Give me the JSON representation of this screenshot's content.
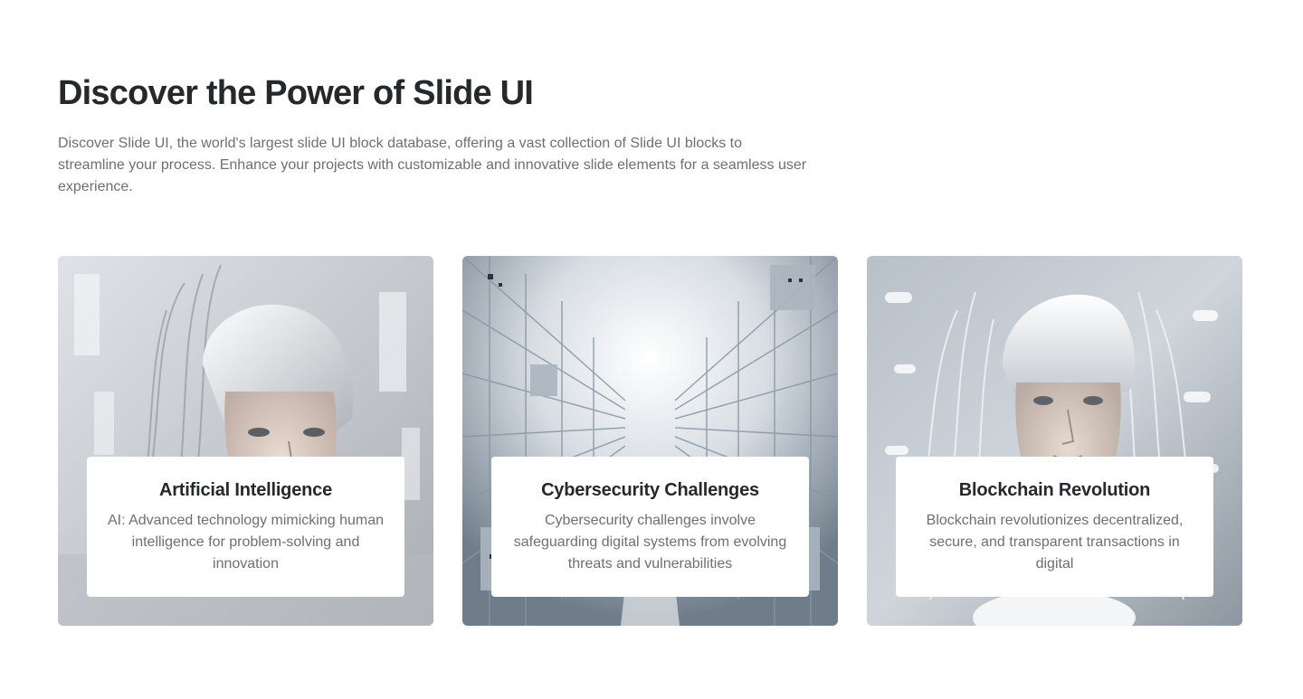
{
  "section": {
    "title": "Discover the Power of Slide UI",
    "description": "Discover Slide UI, the world's largest slide UI block database, offering a vast collection of Slide UI blocks to streamline your process. Enhance your projects with customizable and innovative slide elements for a seamless user experience."
  },
  "cards": [
    {
      "title": "Artificial Intelligence",
      "text": "AI: Advanced technology mimicking human intelligence for problem-solving and innovation",
      "image": "robotic-woman-portrait"
    },
    {
      "title": "Cybersecurity Challenges",
      "text": "Cybersecurity challenges involve safeguarding digital systems from evolving threats and vulnerabilities",
      "image": "server-corridor"
    },
    {
      "title": "Blockchain Revolution",
      "text": "Blockchain revolutionizes decentralized, secure, and transparent transactions in digital",
      "image": "cyborg-helmet-portrait"
    }
  ],
  "colors": {
    "heading": "#25292c",
    "body_text": "#6b7075",
    "background": "#ffffff",
    "card_box": "#ffffff"
  }
}
